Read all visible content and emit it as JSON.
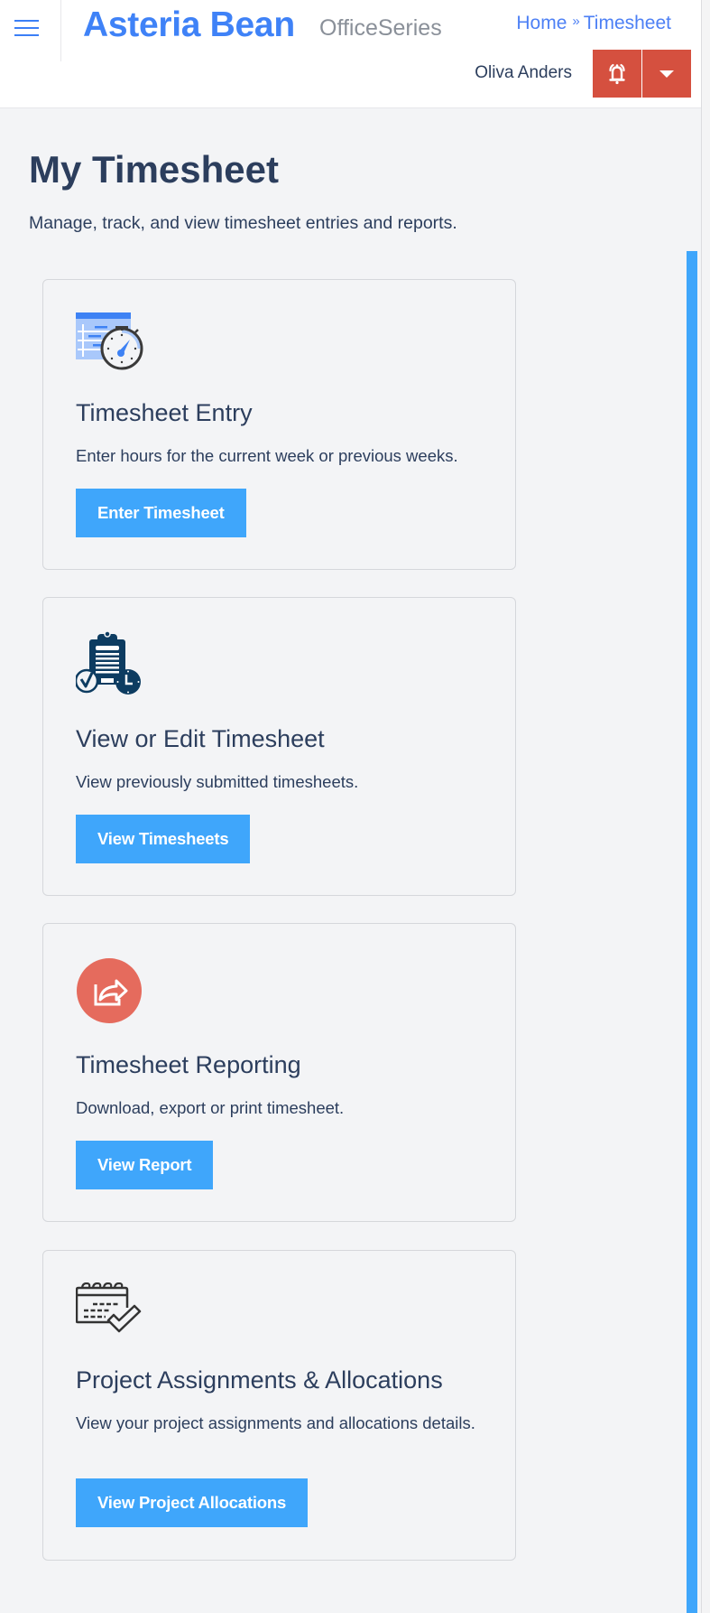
{
  "header": {
    "brand": "Asteria Bean",
    "product": "OfficeSeries",
    "breadcrumb": {
      "home": "Home",
      "separator": "»",
      "current": "Timesheet"
    },
    "user_name": "Oliva Anders",
    "icons": {
      "menu": "hamburger-menu-icon",
      "notifications": "bell-alarm-icon",
      "user_menu": "caret-down-icon"
    },
    "accent_color": "#d5503f"
  },
  "page": {
    "title": "My Timesheet",
    "subtitle": "Manage, track, and view timesheet entries and reports."
  },
  "cards": [
    {
      "icon": "timesheet-stopwatch-icon",
      "title": "Timesheet Entry",
      "description": "Enter hours for the current week or previous weeks.",
      "button": "Enter Timesheet"
    },
    {
      "icon": "clipboard-check-clock-icon",
      "title": "View or Edit Timesheet",
      "description": "View previously submitted timesheets.",
      "button": "View Timesheets"
    },
    {
      "icon": "share-export-icon",
      "title": "Timesheet Reporting",
      "description": "Download, export or print timesheet.",
      "button": "View Report"
    },
    {
      "icon": "calendar-check-icon",
      "title": "Project Assignments & Allocations",
      "description": "View your project assignments and allocations details.",
      "button": "View Project Allocations"
    }
  ],
  "colors": {
    "brand": "#3f82f7",
    "primary_button": "#3fa6fb",
    "danger": "#d5503f",
    "text": "#2c3e5d",
    "report_icon": "#e56b5d",
    "navy_icon": "#0d3c61"
  }
}
